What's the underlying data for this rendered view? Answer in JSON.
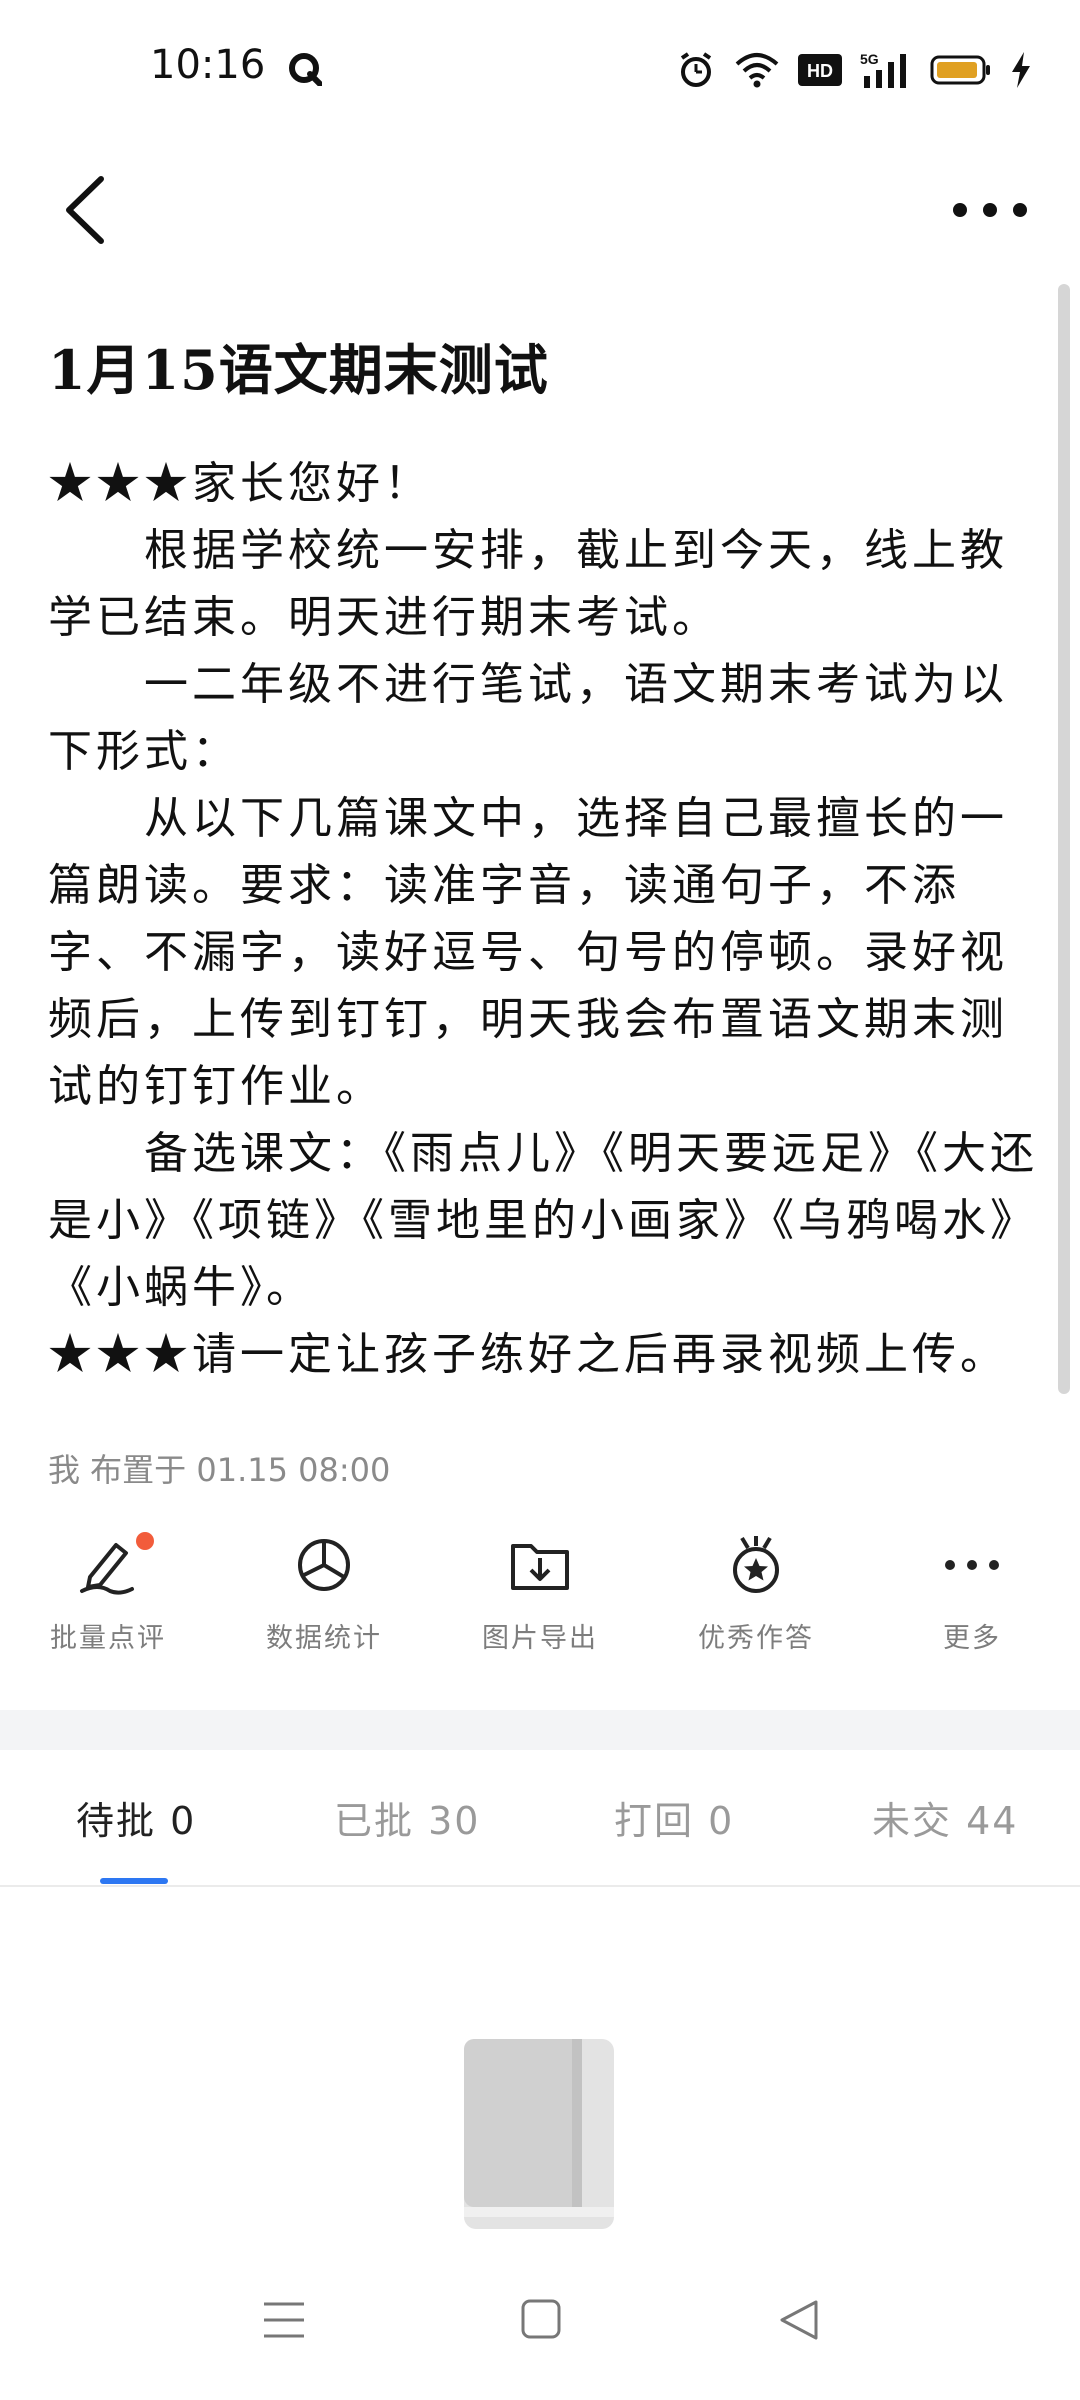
{
  "status_bar": {
    "time": "10:16",
    "icons": [
      "q-icon",
      "alarm-icon",
      "wifi-icon",
      "hd-icon",
      "signal-5g-icon",
      "battery-icon",
      "charging-icon"
    ],
    "hd_label": "HD",
    "network_label": "5G"
  },
  "nav": {
    "back_icon": "chevron-left-icon",
    "more_icon": "more-dots-icon"
  },
  "assignment": {
    "title": "1月15语文期末测试",
    "body": "★★★家长您好！\n　　根据学校统一安排，截止到今天，线上教学已结束。明天进行期末考试。\n　　一二年级不进行笔试，语文期末考试为以下形式：\n　　从以下几篇课文中，选择自己最擅长的一篇朗读。要求：读准字音，读通句子，不添字、不漏字，读好逗号、句号的停顿。录好视频后，上传到钉钉，明天我会布置语文期末测试的钉钉作业。\n　　备选课文：《雨点儿》《明天要远足》《大还是小》《项链》《雪地里的小画家》《乌鸦喝水》《小蜗牛》。\n★★★请一定让孩子练好之后再录视频上传。",
    "meta": "我  布置于 01.15 08:00"
  },
  "actions": [
    {
      "label": "批量点评",
      "icon": "pen-review-icon"
    },
    {
      "label": "数据统计",
      "icon": "pie-chart-icon"
    },
    {
      "label": "图片导出",
      "icon": "folder-download-icon"
    },
    {
      "label": "优秀作答",
      "icon": "medal-star-icon"
    },
    {
      "label": "更多",
      "icon": "more-dots-icon"
    }
  ],
  "tabs": [
    {
      "label": "待批",
      "count": "0"
    },
    {
      "label": "已批",
      "count": "30"
    },
    {
      "label": "打回",
      "count": "0"
    },
    {
      "label": "未交",
      "count": "44"
    }
  ],
  "colors": {
    "accent": "#2d77f2",
    "badge": "#f25c3b",
    "muted": "#8a8a8a",
    "battery": "#e0a022"
  },
  "empty_state": {
    "icon": "book-icon"
  },
  "system_nav": [
    "menu-icon",
    "home-square-icon",
    "back-triangle-icon"
  ]
}
